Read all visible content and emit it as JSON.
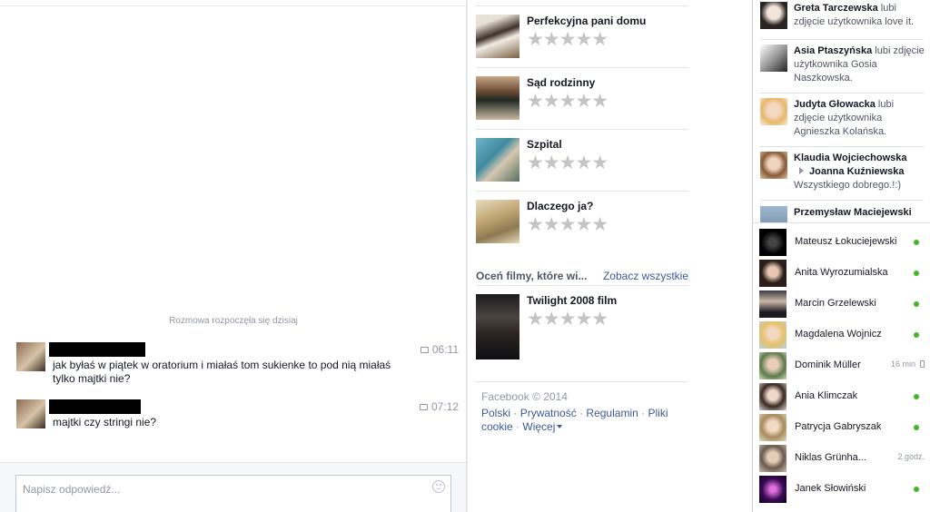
{
  "conversation": {
    "started_label": "Rozmowa rozpoczęła się dzisiaj",
    "messages": [
      {
        "time": "06:11",
        "text": "jak byłaś w piątek w oratorium i miałaś tom sukienke to pod nią miałaś tylko majtki nie?"
      },
      {
        "time": "07:12",
        "text": "majtki czy stringi nie?"
      }
    ],
    "reply_placeholder": "Napisz odpowiedź..."
  },
  "shows": [
    {
      "title": "Perfekcyjna pani domu",
      "stars": "★★★★★"
    },
    {
      "title": "Sąd rodzinny",
      "stars": "★★★★★"
    },
    {
      "title": "Szpital",
      "stars": "★★★★★"
    },
    {
      "title": "Dlaczego ja?",
      "stars": "★★★★★"
    }
  ],
  "films": {
    "heading": "Oceń filmy, które wi...",
    "see_all": "Zobacz wszystkie",
    "items": [
      {
        "title": "Twilight 2008 film",
        "stars": "★★★★★"
      }
    ]
  },
  "footer": {
    "copyright": "Facebook © 2014",
    "links": [
      "Polski",
      "Prywatność",
      "Regulamin",
      "Pliki cookie",
      "Więcej"
    ],
    "sep": "·"
  },
  "ticker": [
    {
      "name": "Greta Tarczewska",
      "rest": " lubi zdjęcie użytkownika love it."
    },
    {
      "name": "Asia Ptaszyńska",
      "rest": " lubi zdjęcie użytkownika Gosia Naszkowska."
    },
    {
      "name": "Judyta Głowacka",
      "rest": " lubi zdjęcie użytkownika Agnieszka Kolańska."
    },
    {
      "name": "Klaudia Wojciechowska",
      "target": "Joanna Kuźniewska",
      "rest": "Wszystkiego dobrego.!:)"
    },
    {
      "name": "Przemysław Maciejewski"
    }
  ],
  "buddies": [
    {
      "name": "Mateusz Łokuciejewski",
      "status": "online"
    },
    {
      "name": "Anita Wyrozumialska",
      "status": "online"
    },
    {
      "name": "Marcin Grzelewski",
      "status": "online"
    },
    {
      "name": "Magdalena Wojnicz",
      "status": "online"
    },
    {
      "name": "Dominik Müller",
      "status": "mobile",
      "idle": "16 min"
    },
    {
      "name": "Ania Klimczak",
      "status": "online"
    },
    {
      "name": "Patrycja Gabryszak",
      "status": "online"
    },
    {
      "name": "Niklas Grünha...",
      "status": "idle",
      "idle": "2 godz."
    },
    {
      "name": "Janek Słowiński",
      "status": "online"
    }
  ],
  "colors": {
    "link": "#3b5998",
    "online": "#42b72a",
    "muted": "#9197a3"
  }
}
